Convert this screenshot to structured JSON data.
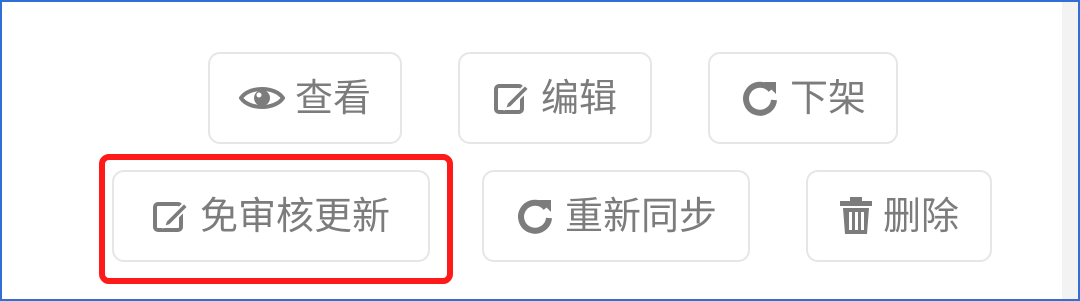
{
  "actions": {
    "row1": [
      {
        "label": "查看",
        "icon": "eye-icon"
      },
      {
        "label": "编辑",
        "icon": "edit-icon"
      },
      {
        "label": "下架",
        "icon": "refresh-icon"
      }
    ],
    "row2": [
      {
        "label": "免审核更新",
        "icon": "edit-icon"
      },
      {
        "label": "重新同步",
        "icon": "refresh-icon"
      },
      {
        "label": "删除",
        "icon": "trash-icon"
      }
    ]
  },
  "colors": {
    "highlight": "#ff1a1a",
    "frame": "#2f6fd6",
    "button_text": "#7c7c7c",
    "button_border": "#e6e6e6"
  }
}
